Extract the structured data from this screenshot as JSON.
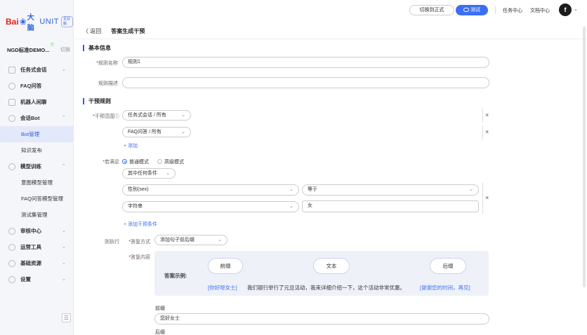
{
  "brand": {
    "bai": "Bai",
    "paw": "❀",
    "du": "大脑",
    "unit": "UNIT",
    "tag": "企业版"
  },
  "bot": {
    "name": "NGD标准DEMO...",
    "switch": "切换",
    "badge": "✓"
  },
  "sidebar": {
    "items": [
      {
        "label": "任务式会话",
        "chev": "⌄"
      },
      {
        "label": "FAQ问答"
      },
      {
        "label": "机器人闲聊"
      },
      {
        "label": "会话Bot",
        "chev": "⌃"
      },
      {
        "label": "Bot管理"
      },
      {
        "label": "知识发布"
      },
      {
        "label": "模型训练",
        "chev": "⌃"
      },
      {
        "label": "意图模型管理"
      },
      {
        "label": "FAQ问答模型管理"
      },
      {
        "label": "测试集管理"
      },
      {
        "label": "审核中心",
        "chev": "⌄"
      },
      {
        "label": "运营工具",
        "chev": "⌄"
      },
      {
        "label": "基础资源",
        "chev": "⌄"
      },
      {
        "label": "设置",
        "chev": "⌄"
      }
    ],
    "collapse": "☰"
  },
  "header": {
    "switch_formal": "切换到正式",
    "test": "测试",
    "task_center": "任务中心",
    "doc_center": "文档中心",
    "avatar": "f",
    "avatar_chev": "⌄"
  },
  "breadcrumb": {
    "back": "〈 返回",
    "title": "答案生成干预"
  },
  "basic": {
    "title": "基本信息",
    "rule_name_label": "规则名称",
    "rule_name_value": "规则1",
    "rule_desc_label": "规则描述",
    "rule_desc_value": ""
  },
  "intervene": {
    "title": "干预规则",
    "scope_label": "干预范围",
    "scope_help": "ⓘ",
    "scope1": "任务式会话 / 所有",
    "scope2": "FAQ问答 / 所有",
    "add": "+ 添加",
    "cond_label": "若满足",
    "mode_normal": "普通模式",
    "mode_advanced": "高级模式",
    "match": "其中任何条件",
    "cond_field1": "性别(sex)",
    "cond_op1": "等于",
    "cond_field2": "字符串",
    "cond_value2": "女",
    "add_cond": "+ 添加干预条件",
    "then_label": "则执行",
    "reply_mode_label": "答复方式",
    "reply_mode": "添加句子前后缀",
    "reply_content_label": "答复内容",
    "close": "×",
    "caret": "⌄"
  },
  "example": {
    "label": "答案示例:",
    "prefix": "前缀",
    "text": "文本",
    "suffix": "后缀",
    "ex_prefix": "[你好呀女士]",
    "ex_body": "我们银行举行了元旦活动，我来详细介绍一下，这个活动非常优惠。",
    "ex_suffix": "[谢谢您的时间，再见]"
  },
  "prefix_field": {
    "label": "前缀",
    "value": "您好女士"
  },
  "suffix_field": {
    "label": "后缀"
  }
}
